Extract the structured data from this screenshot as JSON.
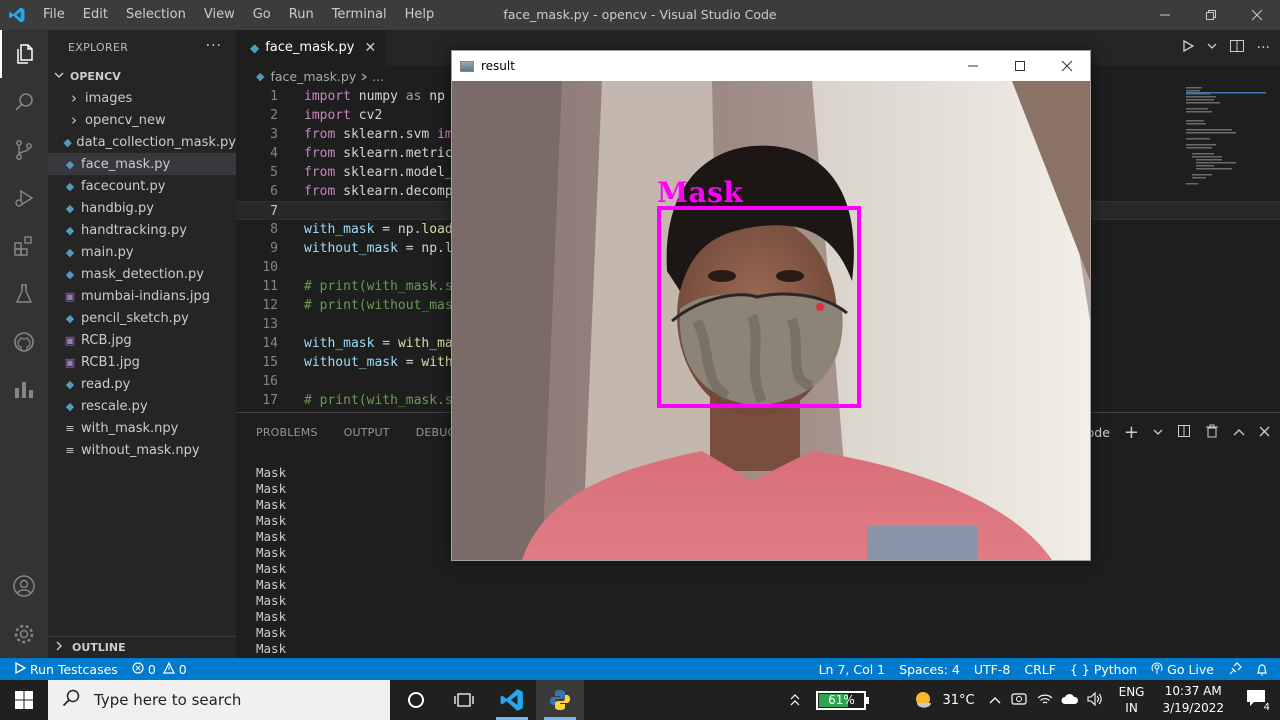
{
  "titlebar": {
    "menus": [
      "File",
      "Edit",
      "Selection",
      "View",
      "Go",
      "Run",
      "Terminal",
      "Help"
    ],
    "title": "face_mask.py - opencv - Visual Studio Code"
  },
  "sidebar": {
    "header": "EXPLORER",
    "folder": "OPENCV",
    "items": [
      {
        "label": "images",
        "type": "folder"
      },
      {
        "label": "opencv_new",
        "type": "folder"
      },
      {
        "label": "data_collection_mask.py",
        "type": "py"
      },
      {
        "label": "face_mask.py",
        "type": "py",
        "selected": true
      },
      {
        "label": "facecount.py",
        "type": "py"
      },
      {
        "label": "handbig.py",
        "type": "py"
      },
      {
        "label": "handtracking.py",
        "type": "py"
      },
      {
        "label": "main.py",
        "type": "py"
      },
      {
        "label": "mask_detection.py",
        "type": "py"
      },
      {
        "label": "mumbai-indians.jpg",
        "type": "img"
      },
      {
        "label": "pencil_sketch.py",
        "type": "py"
      },
      {
        "label": "RCB.jpg",
        "type": "img"
      },
      {
        "label": "RCB1.jpg",
        "type": "img"
      },
      {
        "label": "read.py",
        "type": "py"
      },
      {
        "label": "rescale.py",
        "type": "py"
      },
      {
        "label": "with_mask.npy",
        "type": "file"
      },
      {
        "label": "without_mask.npy",
        "type": "file"
      }
    ],
    "outline": "OUTLINE"
  },
  "editor": {
    "tab": "face_mask.py",
    "breadcrumb_file": "face_mask.py",
    "breadcrumb_more": "...",
    "lines": [
      {
        "n": "1",
        "a": "import",
        "b": " numpy ",
        "c": "as",
        "d": " np"
      },
      {
        "n": "2",
        "a": "import",
        "b": " cv2",
        "c": "",
        "d": ""
      },
      {
        "n": "3",
        "a": "from",
        "b": " sklearn.svm ",
        "c": "im",
        "d": ""
      },
      {
        "n": "4",
        "a": "from",
        "b": " sklearn.metric",
        "c": "",
        "d": ""
      },
      {
        "n": "5",
        "a": "from",
        "b": " sklearn.model_",
        "c": "",
        "d": ""
      },
      {
        "n": "6",
        "a": "from",
        "b": " sklearn.decomp",
        "c": "",
        "d": ""
      },
      {
        "n": "7",
        "a": "",
        "b": "",
        "c": "",
        "d": ""
      },
      {
        "n": "8",
        "a": "",
        "b": "with_mask",
        "c": " = np.",
        "d": "load"
      },
      {
        "n": "9",
        "a": "",
        "b": "without_mask",
        "c": " = np.l",
        "d": ""
      },
      {
        "n": "10",
        "a": "",
        "b": "",
        "c": "",
        "d": ""
      },
      {
        "n": "11",
        "cm": "# print(with_mask.s"
      },
      {
        "n": "12",
        "cm": "# print(without_mas"
      },
      {
        "n": "13",
        "a": "",
        "b": "",
        "c": "",
        "d": ""
      },
      {
        "n": "14",
        "a": "",
        "b": "with_mask",
        "c": " = ",
        "d": "with_ma"
      },
      {
        "n": "15",
        "a": "",
        "b": "without_mask",
        "c": " = ",
        "d": "with"
      },
      {
        "n": "16",
        "a": "",
        "b": "",
        "c": "",
        "d": ""
      },
      {
        "n": "17",
        "cm": "# print(with_mask.s"
      }
    ]
  },
  "panel": {
    "tabs": [
      "PROBLEMS",
      "OUTPUT",
      "DEBUG CO"
    ],
    "terminal_name": "Code",
    "output": [
      "Mask",
      "Mask",
      "Mask",
      "Mask",
      "Mask",
      "Mask",
      "Mask",
      "Mask",
      "Mask",
      "Mask",
      "Mask",
      "Mask"
    ]
  },
  "statusbar": {
    "run": "Run Testcases",
    "errors": "0",
    "warnings": "0",
    "position": "Ln 7, Col 1",
    "spaces": "Spaces: 4",
    "encoding": "UTF-8",
    "eol": "CRLF",
    "language": "Python",
    "golive": "Go Live"
  },
  "result_window": {
    "title": "result",
    "label": "Mask",
    "box_color": "#ff00ff"
  },
  "taskbar": {
    "search_placeholder": "Type here to search",
    "battery": "61%",
    "temperature": "31°C",
    "lang1": "ENG",
    "lang2": "IN",
    "time": "10:37 AM",
    "date": "3/19/2022",
    "notif_count": "4"
  }
}
